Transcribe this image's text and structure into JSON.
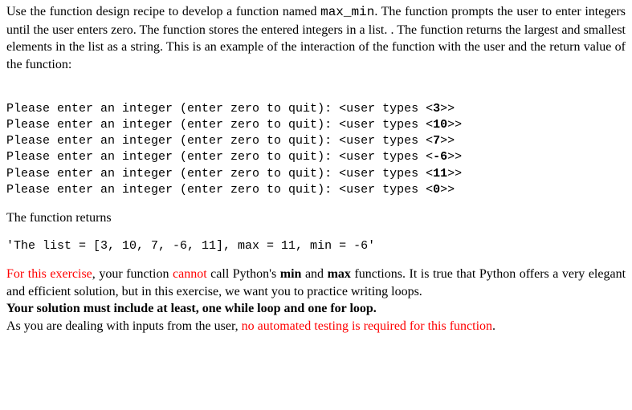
{
  "intro": {
    "p1a": "Use the function design recipe to develop a function named ",
    "func_name": "max_min",
    "p1b": ". The function prompts the user to enter integers until the user enters zero. The function stores the entered integers in a list. . The function returns the largest and smallest elements in the list as a string. This is an example of the interaction of the function with the user and the return value of the function:"
  },
  "interaction": {
    "lines": [
      {
        "prompt": "Please enter an integer (enter zero to quit): <user types <",
        "val": "3",
        "tail": ">>"
      },
      {
        "prompt": "Please enter an integer (enter zero to quit): <user types <",
        "val": "10",
        "tail": ">>"
      },
      {
        "prompt": "Please enter an integer (enter zero to quit): <user types <",
        "val": "7",
        "tail": ">>"
      },
      {
        "prompt": "Please enter an integer (enter zero to quit): <user types <",
        "val": "-6",
        "tail": ">>"
      },
      {
        "prompt": "Please enter an integer (enter zero to quit): <user types <",
        "val": "11",
        "tail": ">>"
      },
      {
        "prompt": "Please enter an integer (enter zero to quit): <user types <",
        "val": "0",
        "tail": ">>"
      }
    ]
  },
  "returns_label": "The function returns",
  "return_value": "'The list = [3, 10, 7, -6, 11], max = 11, min = -6'",
  "notes": {
    "n1a": "For this exercise",
    "n1b": ", your function ",
    "n1c": "cannot",
    "n1d": " call Python's ",
    "n1e": "min",
    "n1f": " and ",
    "n1g": "max",
    "n1h": " functions. It is true that Python offers a very elegant and efficient solution, but in this exercise, we want you to practice writing loops.",
    "n2": "Your solution must include at least, one while loop and one for loop.",
    "n3a": "As you are dealing with inputs from the user, ",
    "n3b": "no automated testing is required for this function",
    "n3c": "."
  }
}
